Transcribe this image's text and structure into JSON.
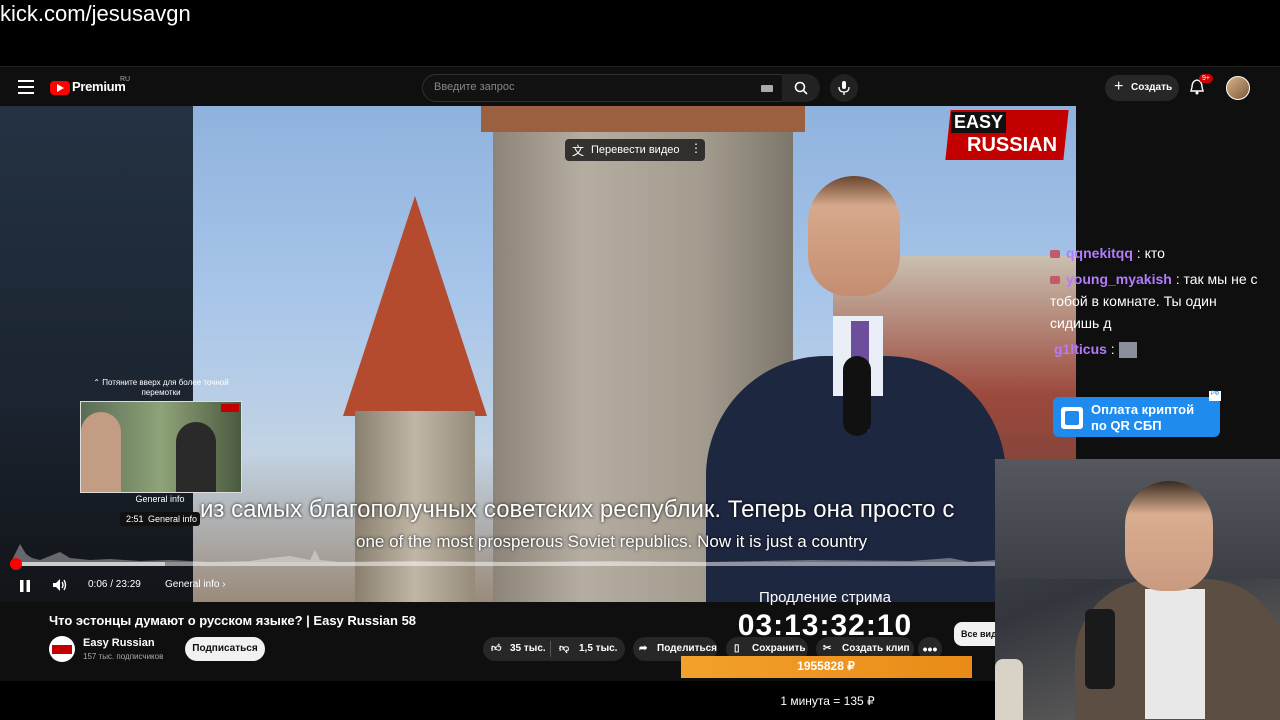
{
  "browser": {
    "url": "kick.com/jesusavgn"
  },
  "header": {
    "logo_text": "Premium",
    "region": "RU",
    "search_placeholder": "Введите запрос",
    "create_label": "Создать",
    "notifications_badge": "9+"
  },
  "video": {
    "translate_label": "Перевести видео",
    "channel_logo_top": "EASY",
    "channel_logo_bottom": "RUSSIAN",
    "subtitle_ru": "из самых благополучных советских республик. Теперь она просто с",
    "subtitle_en": "one of the most prosperous Soviet republics. Now it is just a country",
    "preview_hint": "⌃ Потяните вверх для более точной перемотки",
    "preview_chapter": "General info",
    "preview_time": "2:51",
    "preview_time_chapter": "General info",
    "current_time": "0:06",
    "duration": "23:29",
    "time_display": "0:06 / 23:29",
    "chapter_label": "General info",
    "progress_fraction": 0.004
  },
  "meta": {
    "title": "Что эстонцы думают о русском языке? | Easy Russian 58",
    "channel_name": "Easy Russian",
    "subscribers": "157 тыс. подписчиков",
    "subscribe_label": "Подписаться",
    "likes": "35 тыс.",
    "dislikes": "1,5 тыс.",
    "share_label": "Поделиться",
    "save_label": "Сохранить",
    "clip_label": "Создать клип",
    "more_label": "•••",
    "all_videos_label": "Все вид"
  },
  "stream": {
    "extension_title": "Продление стрима",
    "timer": "03:13:32:10",
    "donation_total": "1955828 ₽",
    "rate": "1 минута = 135 ₽"
  },
  "chat": {
    "messages": [
      {
        "user": "qqnekitqq",
        "text": "кто"
      },
      {
        "user": "young_myakish",
        "text": "так мы не с"
      },
      {
        "user": "",
        "text": "тобой в комнате. Ты один"
      },
      {
        "user": "",
        "text": "сидишь д"
      },
      {
        "user": "g1lticus",
        "text": ""
      }
    ],
    "crypto_line1": "Оплата криптой",
    "crypto_line2": "по QR СБП",
    "crypto_tag": "РФ"
  },
  "colors": {
    "accent": "#ff0000",
    "chat_user": "#b47bff",
    "donation_bar": "#f2a12b",
    "crypto_button": "#1f8bee"
  }
}
